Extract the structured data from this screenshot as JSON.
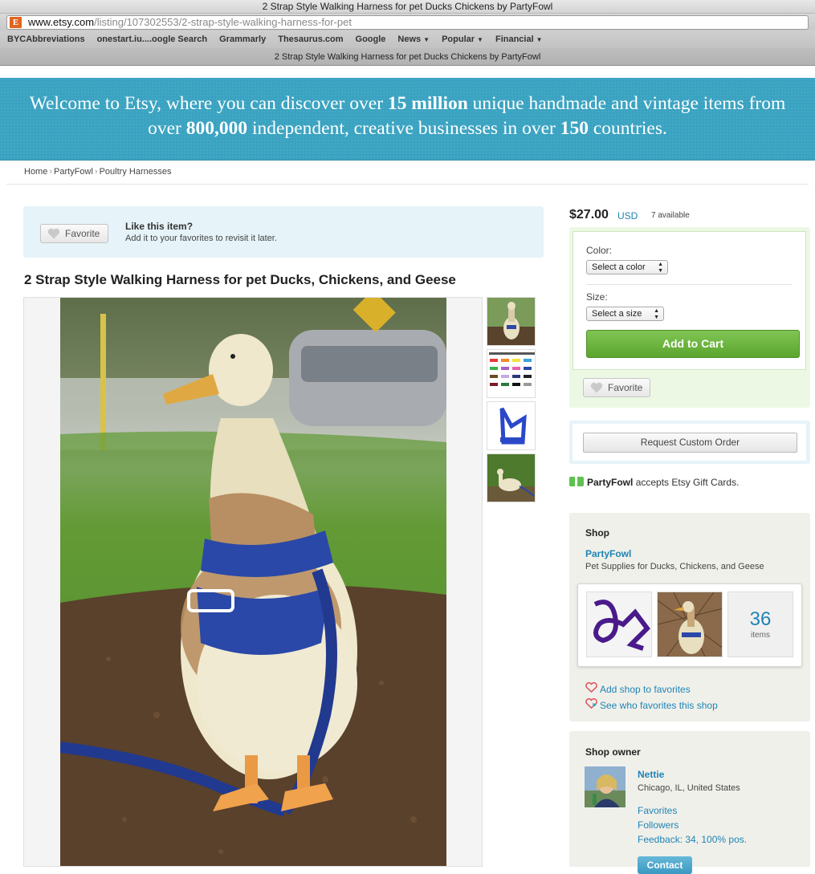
{
  "browser": {
    "window_title": "2 Strap Style Walking Harness for pet Ducks Chickens by PartyFowl",
    "url_domain": "www.etsy.com",
    "url_path": "/listing/107302553/2-strap-style-walking-harness-for-pet",
    "bookmarks": [
      {
        "label": "BYCAbbreviations",
        "menu": false
      },
      {
        "label": "onestart.iu....oogle Search",
        "menu": false
      },
      {
        "label": "Grammarly",
        "menu": false
      },
      {
        "label": "Thesaurus.com",
        "menu": false
      },
      {
        "label": "Google",
        "menu": false
      },
      {
        "label": "News",
        "menu": true
      },
      {
        "label": "Popular",
        "menu": true
      },
      {
        "label": "Financial",
        "menu": true
      }
    ],
    "tab_title": "2 Strap Style Walking Harness for pet Ducks Chickens by PartyFowl"
  },
  "banner": {
    "t1": "Welcome to Etsy, where you can discover over ",
    "b1": "15 million",
    "t2": " unique handmade and vintage items from",
    "t3": "over ",
    "b2": "800,000",
    "t4": " independent, creative businesses in over ",
    "b3": "150",
    "t5": " countries."
  },
  "breadcrumb": {
    "items": [
      "Home",
      "PartyFowl",
      "Poultry Harnesses"
    ],
    "separator": "›"
  },
  "favorite_strip": {
    "button_label": "Favorite",
    "title": "Like this item?",
    "subtitle": "Add it to your favorites to revisit it later."
  },
  "listing": {
    "title": "2 Strap Style Walking Harness for pet Ducks, Chickens, and Geese",
    "thumbnail_count": 4
  },
  "purchase": {
    "price": "$27.00",
    "currency": "USD",
    "availability": "7 available",
    "color_label": "Color:",
    "color_select": "Select a color",
    "size_label": "Size:",
    "size_select": "Select a size",
    "add_to_cart": "Add to Cart",
    "favorite_label": "Favorite",
    "custom_order": "Request Custom Order"
  },
  "gift_cards": {
    "shop": "PartyFowl",
    "text": " accepts Etsy Gift Cards."
  },
  "shop": {
    "heading": "Shop",
    "name": "PartyFowl",
    "tagline": "Pet Supplies for Ducks, Chickens, and Geese",
    "items_count": "36",
    "items_label": "items",
    "add_favorites": "Add shop to favorites",
    "see_favorites": "See who favorites this shop"
  },
  "owner": {
    "heading": "Shop owner",
    "name": "Nettie",
    "location": "Chicago, IL, United States",
    "links": [
      "Favorites",
      "Followers",
      "Feedback: 34, 100% pos."
    ],
    "contact": "Contact"
  },
  "colors": {
    "etsy_orange": "#e1641f",
    "banner_blue": "#3aa3c1",
    "link_blue": "#1f84b5",
    "cart_green": "#5ba52e"
  },
  "icons": [
    "etsy-favicon",
    "heart-icon",
    "gift-card-icon",
    "add-favorite-heart-icon",
    "see-favorites-heart-icon",
    "select-arrows-icon"
  ]
}
